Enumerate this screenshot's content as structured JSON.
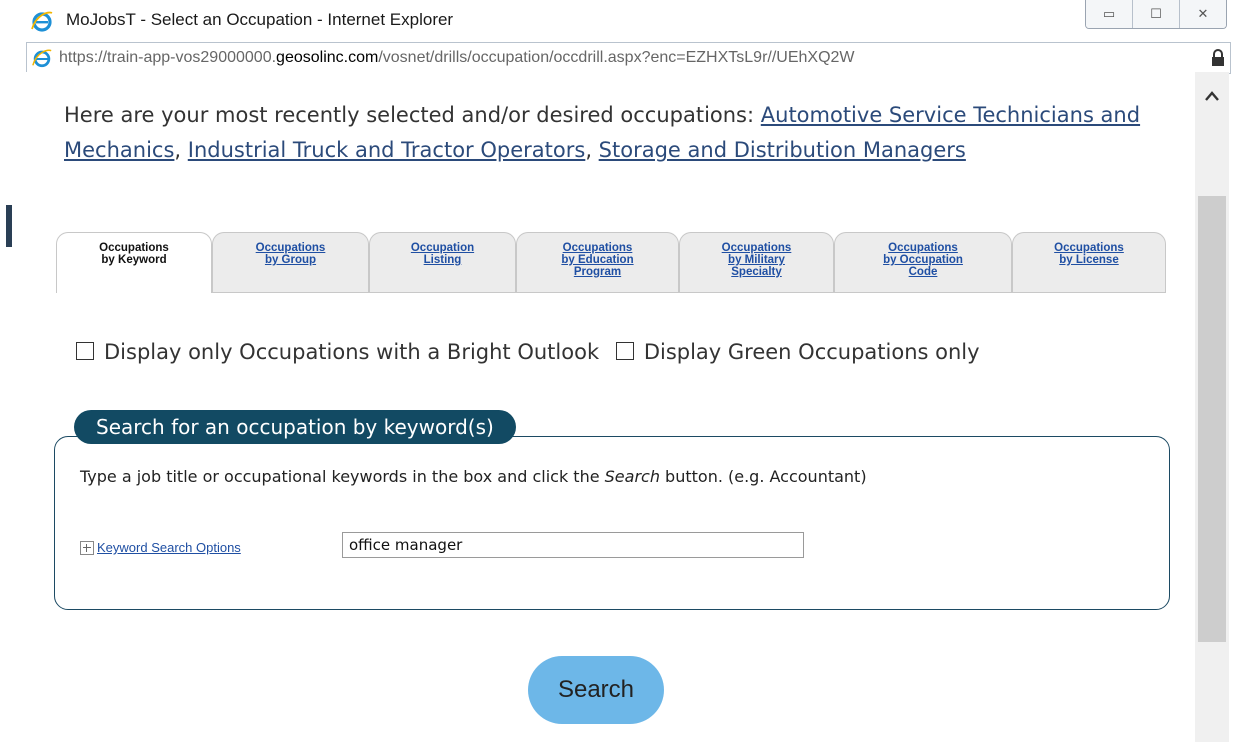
{
  "window": {
    "title": "MoJobsT - Select an Occupation - Internet Explorer",
    "controls": [
      "▭",
      "☐",
      "✕"
    ]
  },
  "address_bar": {
    "url_protocol": "https://",
    "url_subdomain": "train-app-vos29000000.",
    "url_domain": "geosolinc.com",
    "url_path": "/vosnet/drills/occupation/occdrill.aspx?enc=EZHXTsL9r//UEhXQ2W"
  },
  "recent": {
    "intro": "Here are your most recently selected and/or desired occupations: ",
    "links": [
      "Automotive Service Technicians and Mechanics",
      "Industrial Truck and Tractor Operators",
      "Storage and Distribution Managers"
    ],
    "separator": ", "
  },
  "tabs": [
    {
      "line1": "Occupations",
      "line2": "by Keyword",
      "line3": "",
      "active": true
    },
    {
      "line1": "Occupations",
      "line2": "by Group",
      "line3": "",
      "active": false
    },
    {
      "line1": "Occupation",
      "line2": "Listing",
      "line3": "",
      "active": false
    },
    {
      "line1": "Occupations",
      "line2": "by Education",
      "line3": "Program",
      "active": false
    },
    {
      "line1": "Occupations",
      "line2": "by Military",
      "line3": "Specialty",
      "active": false
    },
    {
      "line1": "Occupations",
      "line2": "by Occupation",
      "line3": "Code",
      "active": false
    },
    {
      "line1": "Occupations",
      "line2": "by License",
      "line3": "",
      "active": false
    }
  ],
  "filters": {
    "bright_outlook": "Display only Occupations with a Bright Outlook",
    "green": "Display Green Occupations only"
  },
  "search": {
    "legend": "Search for an occupation by keyword(s)",
    "instructions_before": "Type a job title or occupational keywords in the box and click the ",
    "instructions_em": "Search",
    "instructions_after": " button. (e.g. Accountant)",
    "keyword_options_label": "Keyword Search Options",
    "keyword_value": "office manager",
    "button_label": "Search"
  },
  "colors": {
    "legend_bg": "#124a63",
    "button_bg": "#6db7e8",
    "link": "#2b4a7a"
  }
}
